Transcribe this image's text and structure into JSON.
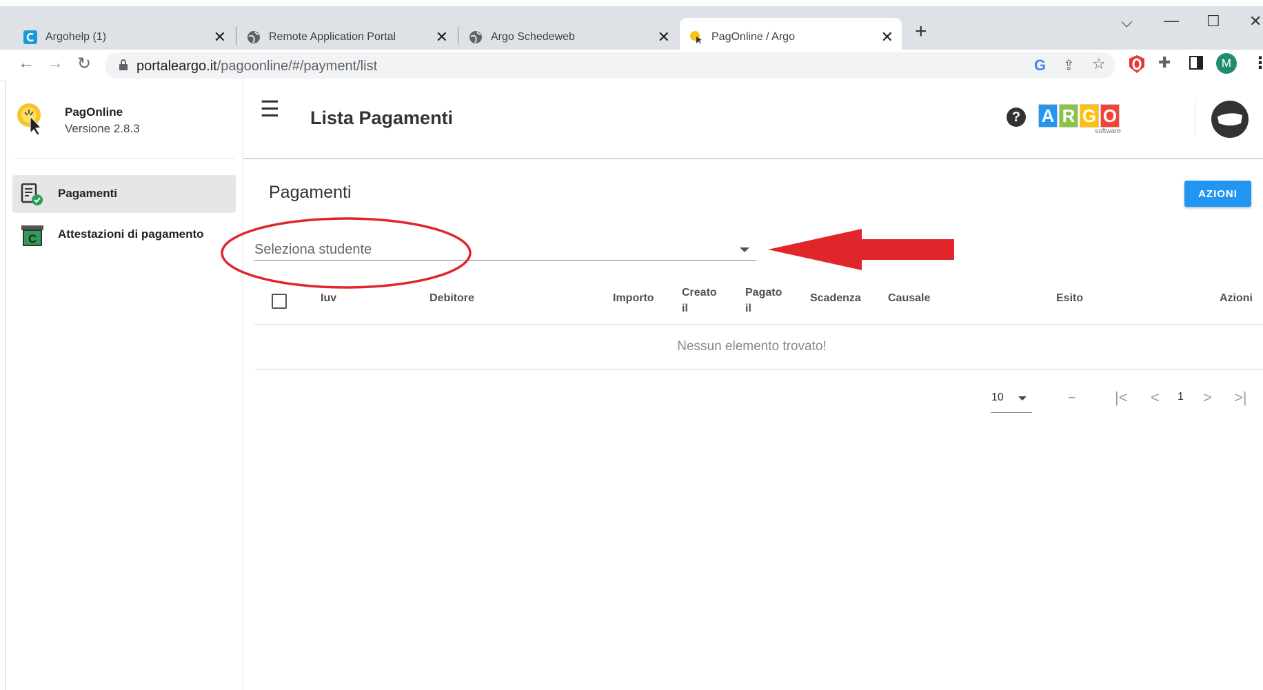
{
  "browser": {
    "tabs": [
      {
        "title": "Argohelp (1)"
      },
      {
        "title": "Remote Application Portal"
      },
      {
        "title": "Argo Schedeweb"
      },
      {
        "title": "PagOnline / Argo"
      }
    ],
    "url_host": "portaleargo.it",
    "url_path": "/pagoonline/#/payment/list",
    "profile_initial": "M"
  },
  "sidebar": {
    "app_name": "PagOnline",
    "version": "Versione 2.8.3",
    "items": [
      {
        "label": "Pagamenti",
        "icon": "receipt-check-icon",
        "selected": true
      },
      {
        "label": "Attestazioni di pagamento",
        "icon": "certificate-icon",
        "selected": false
      }
    ]
  },
  "header": {
    "title": "Lista Pagamenti",
    "logo_letters": [
      "A",
      "R",
      "G",
      "O"
    ],
    "logo_colors": [
      "#2196f3",
      "#8bc34a",
      "#ffc107",
      "#f44336"
    ],
    "logo_sub": "software"
  },
  "main": {
    "section_title": "Pagamenti",
    "action_button": "AZIONI",
    "student_select_placeholder": "Seleziona studente",
    "columns": [
      "Iuv",
      "Debitore",
      "Importo",
      "Creato il",
      "Pagato il",
      "Scadenza",
      "Causale",
      "Esito",
      "Azioni"
    ],
    "empty_message": "Nessun elemento trovato!",
    "pagination": {
      "page_size": "10",
      "range": "–",
      "page": "1"
    }
  },
  "annotation": {
    "color": "#e0262b"
  }
}
